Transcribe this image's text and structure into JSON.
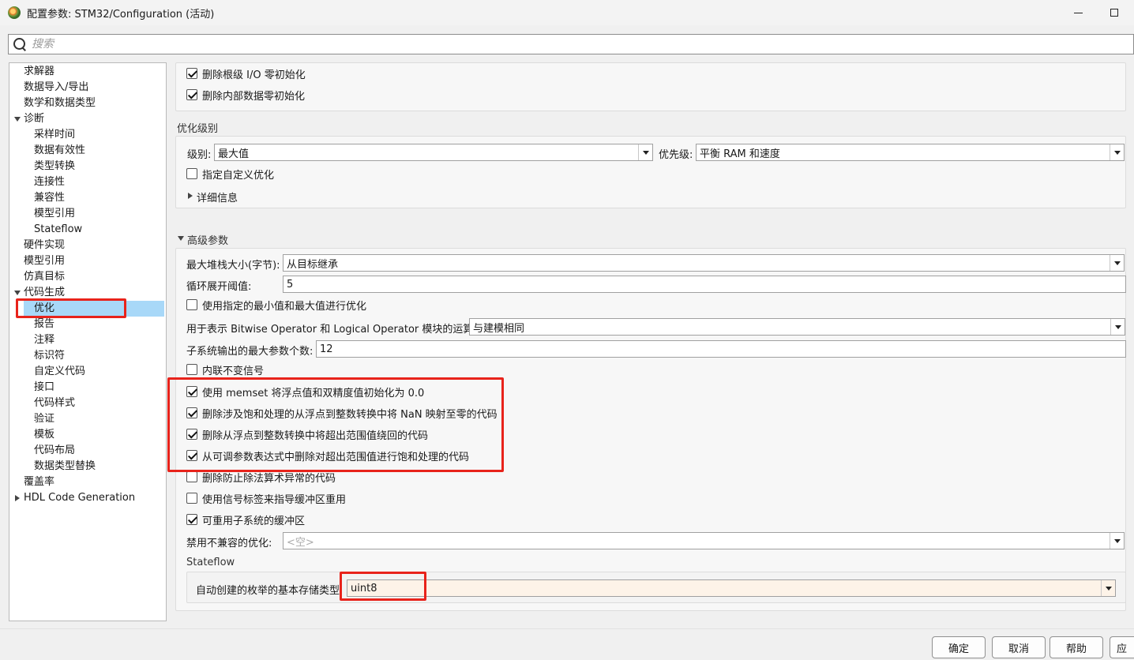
{
  "window": {
    "title": "配置参数: STM32/Configuration (活动)"
  },
  "search": {
    "placeholder": "搜索"
  },
  "tree": {
    "items": [
      "求解器",
      "数据导入/导出",
      "数学和数据类型",
      "诊断",
      "采样时间",
      "数据有效性",
      "类型转换",
      "连接性",
      "兼容性",
      "模型引用",
      "Stateflow",
      "硬件实现",
      "模型引用",
      "仿真目标",
      "代码生成",
      "优化",
      "报告",
      "注释",
      "标识符",
      "自定义代码",
      "接口",
      "代码样式",
      "验证",
      "模板",
      "代码布局",
      "数据类型替换",
      "覆盖率",
      "HDL Code Generation"
    ]
  },
  "top_checks": {
    "root_io_zero_init": "删除根级 I/O 零初始化",
    "internal_data_zero_init": "删除内部数据零初始化"
  },
  "opt_level": {
    "title": "优化级别",
    "level_label": "级别:",
    "level_value": "最大值",
    "priority_label": "优先级:",
    "priority_value": "平衡 RAM 和速度",
    "custom_opt": "指定自定义优化",
    "details": "详细信息"
  },
  "advanced": {
    "title": "高级参数",
    "max_stack_label": "最大堆栈大小(字节):",
    "max_stack_value": "从目标继承",
    "loop_unroll_label": "循环展开阈值:",
    "loop_unroll_value": "5",
    "use_minmax": "使用指定的最小值和最大值进行优化",
    "bitwise_label": "用于表示 Bitwise Operator 和 Logical Operator 模块的运算符:",
    "bitwise_value": "与建模相同",
    "max_args_label": "子系统输出的最大参数个数:",
    "max_args_value": "12",
    "inline_invariant": "内联不变信号",
    "memset": "使用 memset 将浮点值和双精度值初始化为 0.0",
    "nan_to_zero": "删除涉及饱和处理的从浮点到整数转换中将 NaN 映射至零的代码",
    "wrap_code": "删除从浮点到整数转换中将超出范围值绕回的代码",
    "tunable_sat": "从可调参数表达式中删除对超出范围值进行饱和处理的代码",
    "div_exception": "删除防止除法算术异常的代码",
    "signal_label_buffer": "使用信号标签来指导缓冲区重用",
    "reuse_buffer": "可重用子系统的缓冲区",
    "disable_incompat_label": "禁用不兼容的优化:",
    "disable_incompat_value": "<空>"
  },
  "stateflow": {
    "title": "Stateflow",
    "enum_type_label": "自动创建的枚举的基本存储类型",
    "enum_type_value": "uint8"
  },
  "buttons": {
    "ok": "确定",
    "cancel": "取消",
    "help": "帮助",
    "apply": "应"
  }
}
